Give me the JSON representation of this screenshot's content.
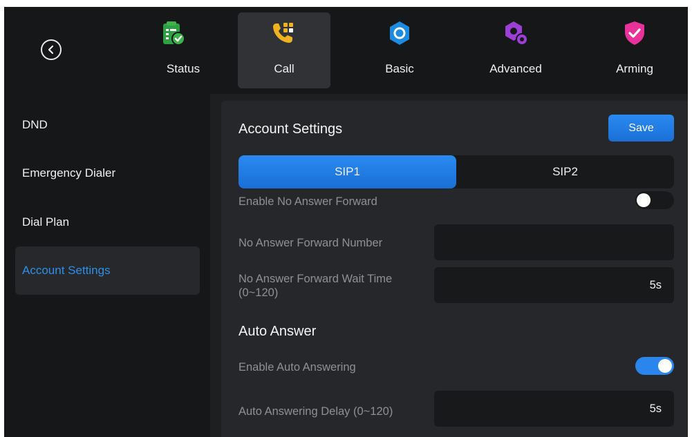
{
  "nav": {
    "tabs": [
      {
        "label": "Status",
        "icon": "status-clipboard-icon",
        "color": "#3db24a"
      },
      {
        "label": "Call",
        "icon": "phone-keypad-icon",
        "color": "#f0b21f",
        "active": true
      },
      {
        "label": "Basic",
        "icon": "gear-icon",
        "color": "#1f8be0"
      },
      {
        "label": "Advanced",
        "icon": "advanced-gear-icon",
        "color": "#9b3fd6"
      },
      {
        "label": "Arming",
        "icon": "shield-check-icon",
        "color": "#e8329a"
      }
    ]
  },
  "sidebar": {
    "items": [
      {
        "label": "DND"
      },
      {
        "label": "Emergency Dialer"
      },
      {
        "label": "Dial Plan"
      },
      {
        "label": "Account Settings",
        "active": true
      }
    ]
  },
  "panel": {
    "title": "Account Settings",
    "save_label": "Save",
    "segments": [
      "SIP1",
      "SIP2"
    ],
    "no_answer_forward_label": "Enable No Answer Forward",
    "no_answer_forward_enabled": false,
    "forward_number_label": "No Answer Forward Number",
    "forward_number_value": "",
    "wait_time_label_line1": "No Answer Forward Wait Time",
    "wait_time_label_line2": "(0~120)",
    "wait_time_value": "5s",
    "auto_answer_heading": "Auto Answer",
    "auto_answering_label": "Enable Auto Answering",
    "auto_answering_enabled": true,
    "auto_answer_delay_label": "Auto Answering Delay (0~120)",
    "auto_answer_delay_value": "5s"
  },
  "colors": {
    "accent": "#1f7fe6",
    "active_sidebar_text": "#2f8fe8",
    "background": "#1e1f21"
  }
}
